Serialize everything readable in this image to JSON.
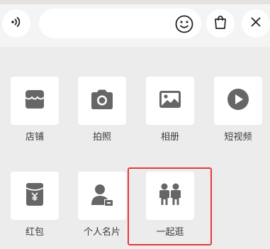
{
  "toolbar": {
    "voice_icon": "voice-input-icon",
    "emoji_icon": "smiley-icon",
    "bag_icon": "shopping-bag-icon",
    "close_icon": "close-icon",
    "input_value": ""
  },
  "menu": {
    "items": [
      {
        "label": "店铺",
        "icon": "shop-icon"
      },
      {
        "label": "拍照",
        "icon": "camera-icon"
      },
      {
        "label": "相册",
        "icon": "photo-album-icon"
      },
      {
        "label": "短视频",
        "icon": "play-icon"
      },
      {
        "label": "红包",
        "icon": "red-packet-icon"
      },
      {
        "label": "个人名片",
        "icon": "contact-card-icon"
      },
      {
        "label": "一起逛",
        "icon": "two-people-icon"
      }
    ]
  },
  "colors": {
    "icon": "#666666",
    "highlight": "#e53a3a",
    "background": "#ececec"
  }
}
